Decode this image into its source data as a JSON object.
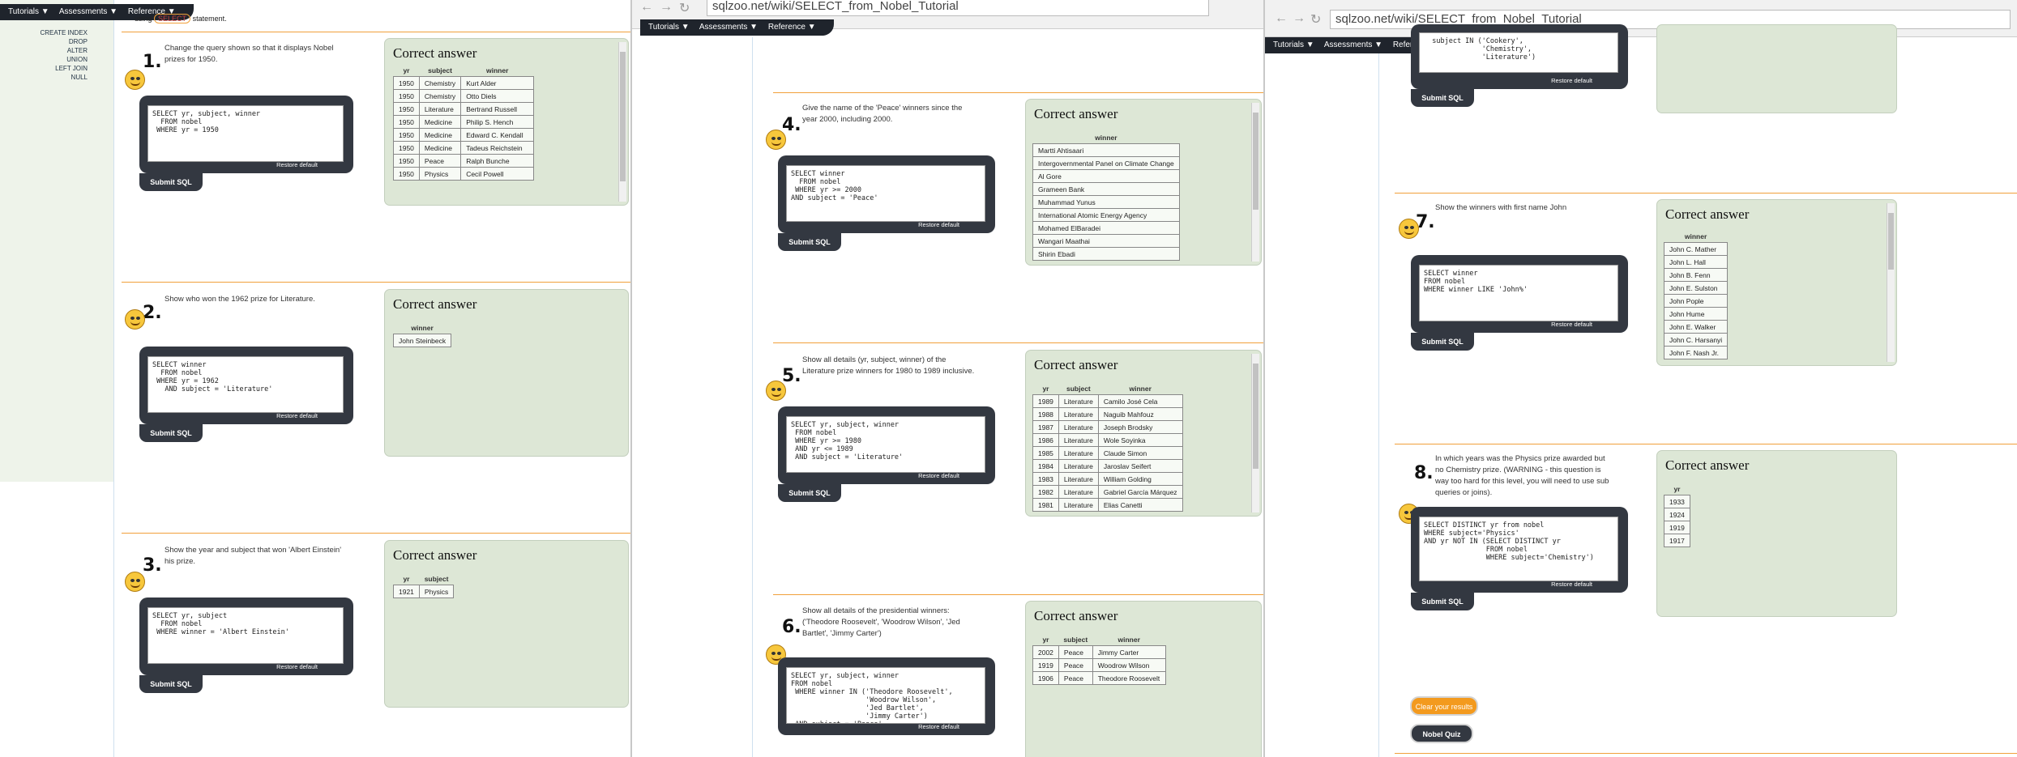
{
  "nav_menu": {
    "items": [
      "Tutorials ▼",
      "Assessments ▼",
      "Reference ▼"
    ]
  },
  "url": "sqlzoo.net/wiki/SELECT_from_Nobel_Tutorial",
  "left_nav_links": [
    "CREATE INDEX",
    "DROP",
    "ALTER",
    "UNION",
    "LEFT JOIN",
    "NULL"
  ],
  "intro": {
    "lead": "using",
    "keyword": "SELECT",
    "tail": "statement."
  },
  "labels": {
    "correct_answer": "Correct answer",
    "restore_default": "Restore default",
    "submit_sql": "Submit SQL"
  },
  "buttons": {
    "clear_results": "Clear your results",
    "nobel_quiz": "Nobel Quiz"
  },
  "questions": [
    {
      "num": "1.",
      "text": "Change the query shown so that it displays Nobel prizes for 1950.",
      "code": "SELECT yr, subject, winner\n  FROM nobel\n WHERE yr = 1950",
      "columns": [
        "yr",
        "subject",
        "winner"
      ],
      "rows": [
        [
          "1950",
          "Chemistry",
          "Kurt Alder"
        ],
        [
          "1950",
          "Chemistry",
          "Otto Diels"
        ],
        [
          "1950",
          "Literature",
          "Bertrand Russell"
        ],
        [
          "1950",
          "Medicine",
          "Philip S. Hench"
        ],
        [
          "1950",
          "Medicine",
          "Edward C. Kendall"
        ],
        [
          "1950",
          "Medicine",
          "Tadeus Reichstein"
        ],
        [
          "1950",
          "Peace",
          "Ralph Bunche"
        ],
        [
          "1950",
          "Physics",
          "Cecil Powell"
        ]
      ]
    },
    {
      "num": "2.",
      "text": "Show who won the 1962 prize for Literature.",
      "code": "SELECT winner\n  FROM nobel\n WHERE yr = 1962\n   AND subject = 'Literature'",
      "columns": [
        "winner"
      ],
      "rows": [
        [
          "John Steinbeck"
        ]
      ]
    },
    {
      "num": "3.",
      "text": "Show the year and subject that won 'Albert Einstein' his prize.",
      "code": "SELECT yr, subject\n  FROM nobel\n WHERE winner = 'Albert Einstein'",
      "columns": [
        "yr",
        "subject"
      ],
      "rows": [
        [
          "1921",
          "Physics"
        ]
      ]
    },
    {
      "num": "4.",
      "text": "Give the name of the 'Peace' winners since the year 2000, including 2000.",
      "code": "SELECT winner\n  FROM nobel\n WHERE yr >= 2000\nAND subject = 'Peace'",
      "columns": [
        "winner"
      ],
      "rows": [
        [
          "Martti Ahtisaari"
        ],
        [
          "Intergovernmental Panel on Climate Change"
        ],
        [
          "Al Gore"
        ],
        [
          "Grameen Bank"
        ],
        [
          "Muhammad Yunus"
        ],
        [
          "International Atomic Energy Agency"
        ],
        [
          "Mohamed ElBaradei"
        ],
        [
          "Wangari Maathai"
        ],
        [
          "Shirin Ebadi"
        ]
      ]
    },
    {
      "num": "5.",
      "text": "Show all details (yr, subject, winner) of the Literature prize winners for 1980 to 1989 inclusive.",
      "code": "SELECT yr, subject, winner\n FROM nobel\n WHERE yr >= 1980\n AND yr <= 1989\n AND subject = 'Literature'",
      "columns": [
        "yr",
        "subject",
        "winner"
      ],
      "rows": [
        [
          "1989",
          "Literature",
          "Camilo José Cela"
        ],
        [
          "1988",
          "Literature",
          "Naguib Mahfouz"
        ],
        [
          "1987",
          "Literature",
          "Joseph Brodsky"
        ],
        [
          "1986",
          "Literature",
          "Wole Soyinka"
        ],
        [
          "1985",
          "Literature",
          "Claude Simon"
        ],
        [
          "1984",
          "Literature",
          "Jaroslav Seifert"
        ],
        [
          "1983",
          "Literature",
          "William Golding"
        ],
        [
          "1982",
          "Literature",
          "Gabriel García Márquez"
        ],
        [
          "1981",
          "Literature",
          "Elias Canetti"
        ]
      ]
    },
    {
      "num": "6.",
      "text": "Show all details of the presidential winners: ('Theodore Roosevelt', 'Woodrow Wilson', 'Jed Bartlet', 'Jimmy Carter')",
      "code": "SELECT yr, subject, winner\nFROM nobel\n WHERE winner IN ('Theodore Roosevelt',\n                  'Woodrow Wilson',\n                  'Jed Bartlet',\n                  'Jimmy Carter')\n AND subject = 'Peace'",
      "columns": [
        "yr",
        "subject",
        "winner"
      ],
      "rows": [
        [
          "2002",
          "Peace",
          "Jimmy Carter"
        ],
        [
          "1919",
          "Peace",
          "Woodrow Wilson"
        ],
        [
          "1906",
          "Peace",
          "Theodore Roosevelt"
        ]
      ]
    },
    {
      "num": "7.",
      "text": "Show the winners with first name John",
      "code": "SELECT winner\nFROM nobel\nWHERE winner LIKE 'John%'",
      "columns": [
        "winner"
      ],
      "rows": [
        [
          "John C. Mather"
        ],
        [
          "John L. Hall"
        ],
        [
          "John B. Fenn"
        ],
        [
          "John E. Sulston"
        ],
        [
          "John Pople"
        ],
        [
          "John Hume"
        ],
        [
          "John E. Walker"
        ],
        [
          "John C. Harsanyi"
        ],
        [
          "John F. Nash Jr."
        ]
      ]
    },
    {
      "num": "8.",
      "text": "In which years was the Physics prize awarded but no Chemistry prize. (WARNING - this question is way too hard for this level, you will need to use sub queries or joins).",
      "code": "SELECT DISTINCT yr from nobel\nWHERE subject='Physics'\nAND yr NOT IN (SELECT DISTINCT yr\n               FROM nobel\n               WHERE subject='Chemistry')",
      "columns": [
        "yr"
      ],
      "rows": [
        [
          "1933"
        ],
        [
          "1924"
        ],
        [
          "1919"
        ],
        [
          "1917"
        ]
      ]
    }
  ],
  "top_code_fragment": "  subject IN ('Cookery',\n              'Chemistry',\n              'Literature')",
  "colors": {
    "accent_orange": "#f1a03b",
    "dark": "#333841",
    "answer_bg": "#dde7d6",
    "nav_bg": "#eef3ea"
  }
}
